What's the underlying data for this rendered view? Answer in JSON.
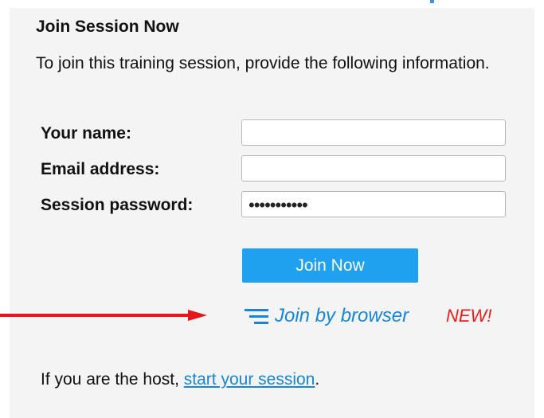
{
  "form": {
    "title": "Join Session Now",
    "intro": "To join this training session, provide the following information.",
    "fields": {
      "name_label": "Your name:",
      "name_value": "",
      "email_label": "Email address:",
      "email_value": "",
      "password_label": "Session password:",
      "password_value": "•••••••••••"
    },
    "join_button_label": "Join Now",
    "browser_link": {
      "label": "Join by browser",
      "icon": "menu-lines-icon",
      "badge": "NEW!"
    },
    "host": {
      "prefix": "If you are the host, ",
      "link_label": "start your session",
      "suffix": "."
    }
  },
  "colors": {
    "panel_background": "#f4f4f4",
    "button": "#1fa1ef",
    "link": "#1785d8",
    "badge": "#ef1b1b",
    "arrow": "#e8161b"
  }
}
